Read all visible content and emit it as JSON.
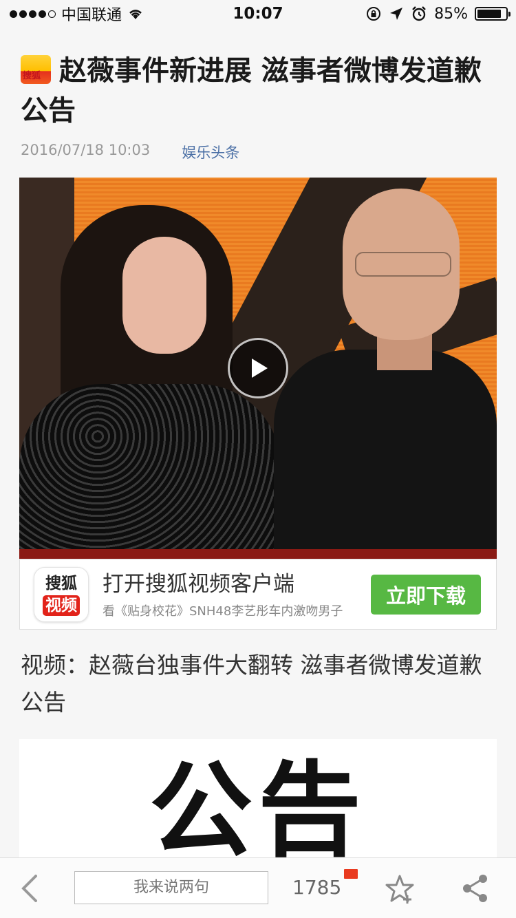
{
  "status_bar": {
    "carrier": "中国联通",
    "time": "10:07",
    "battery_percent": "85%",
    "battery_level": 0.85,
    "icons": [
      "signal-icon",
      "wifi-icon",
      "rotation-lock-icon",
      "location-icon",
      "alarm-icon",
      "battery-icon"
    ]
  },
  "article": {
    "logo_text": "搜狐",
    "title": "赵薇事件新进展 滋事者微博发道歉公告",
    "date": "2016/07/18 10:03",
    "source": "娱乐头条"
  },
  "video": {
    "play_icon": "play-icon"
  },
  "app_banner": {
    "icon_top": "搜狐",
    "icon_bottom": "视频",
    "title": "打开搜狐视频客户端",
    "subtitle": "看《贴身校花》SNH48李艺彤车内激吻男子",
    "button_label": "立即下载"
  },
  "video_caption": "视频：赵薇台独事件大翻转 滋事者微博发道歉公告",
  "notice_image": {
    "text": "公告"
  },
  "bottom_bar": {
    "comment_placeholder": "我来说两句",
    "comment_count": "1785",
    "colors": {
      "flag": "#e93a1f"
    }
  }
}
